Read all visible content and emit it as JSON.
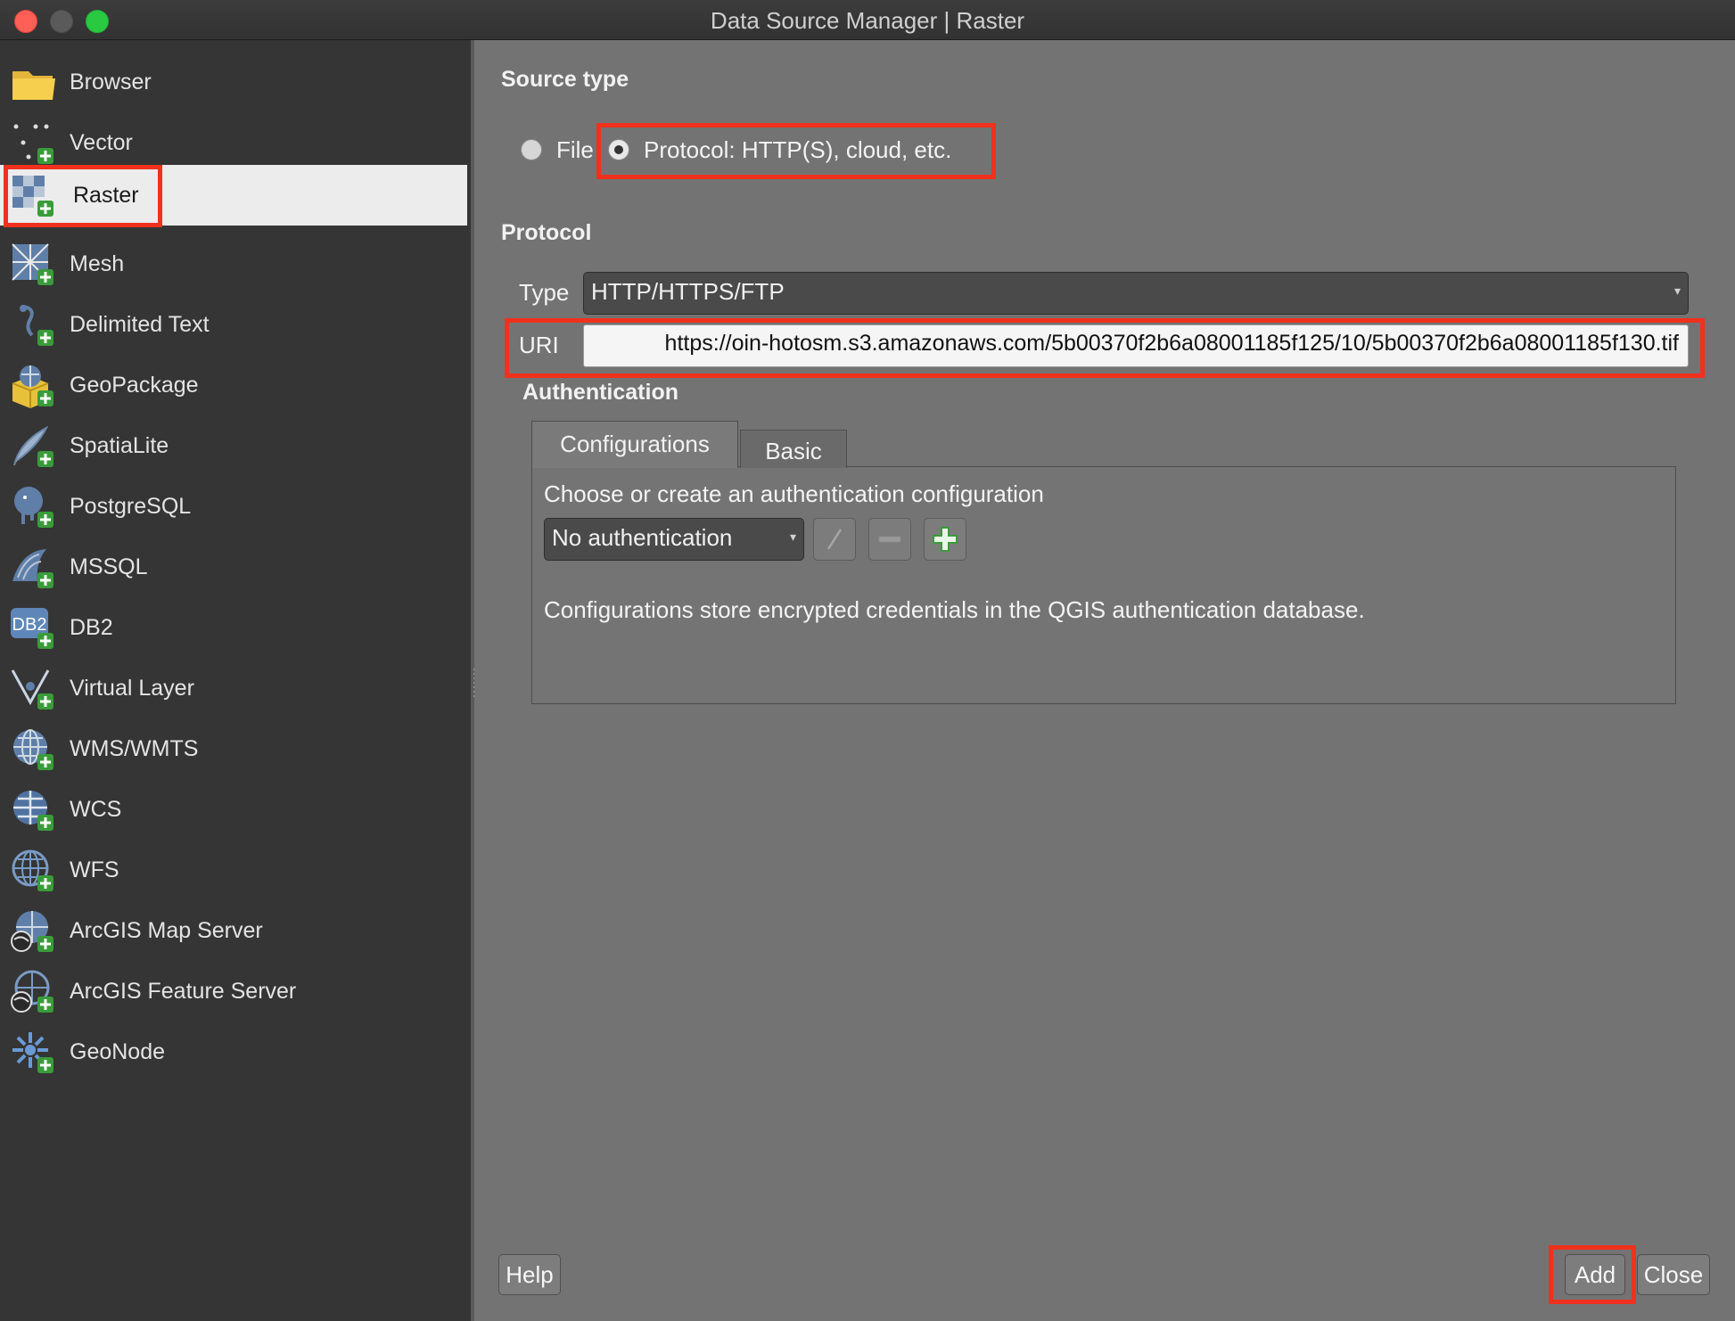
{
  "window": {
    "title": "Data Source Manager | Raster"
  },
  "sidebar": {
    "items": [
      {
        "label": "Browser",
        "icon": "folder-icon"
      },
      {
        "label": "Vector",
        "icon": "vector-add-icon"
      },
      {
        "label": "Raster",
        "icon": "raster-add-icon",
        "selected": true
      },
      {
        "label": "Mesh",
        "icon": "mesh-add-icon"
      },
      {
        "label": "Delimited Text",
        "icon": "delimited-text-add-icon"
      },
      {
        "label": "GeoPackage",
        "icon": "geopackage-add-icon"
      },
      {
        "label": "SpatiaLite",
        "icon": "spatialite-add-icon"
      },
      {
        "label": "PostgreSQL",
        "icon": "postgresql-add-icon"
      },
      {
        "label": "MSSQL",
        "icon": "mssql-add-icon"
      },
      {
        "label": "DB2",
        "icon": "db2-add-icon"
      },
      {
        "label": "Virtual Layer",
        "icon": "virtual-layer-add-icon"
      },
      {
        "label": "WMS/WMTS",
        "icon": "wms-add-icon"
      },
      {
        "label": "WCS",
        "icon": "wcs-add-icon"
      },
      {
        "label": "WFS",
        "icon": "wfs-add-icon"
      },
      {
        "label": "ArcGIS Map Server",
        "icon": "arcgis-map-server-add-icon"
      },
      {
        "label": "ArcGIS Feature Server",
        "icon": "arcgis-feature-server-add-icon"
      },
      {
        "label": "GeoNode",
        "icon": "geonode-add-icon"
      }
    ],
    "db2_icon_text": "DB2"
  },
  "source_type": {
    "title": "Source type",
    "file_label": "File",
    "protocol_label": "Protocol: HTTP(S), cloud, etc.",
    "selected": "protocol"
  },
  "protocol": {
    "title": "Protocol",
    "type_label": "Type",
    "type_value": "HTTP/HTTPS/FTP",
    "uri_label": "URI",
    "uri_value": "https://oin-hotosm.s3.amazonaws.com/5b00370f2b6a08001185f125/10/5b00370f2b6a08001185f130.tif"
  },
  "authentication": {
    "title": "Authentication",
    "tabs": [
      "Configurations",
      "Basic"
    ],
    "active_tab": "Configurations",
    "prompt": "Choose or create an authentication configuration",
    "config_value": "No authentication",
    "description": "Configurations store encrypted credentials in the QGIS authentication database."
  },
  "buttons": {
    "help": "Help",
    "add": "Add",
    "close": "Close"
  },
  "colors": {
    "highlight": "#f0311d",
    "sidebar_bg": "#353535",
    "panel_bg": "#737373",
    "selected_bg": "#ececec"
  }
}
